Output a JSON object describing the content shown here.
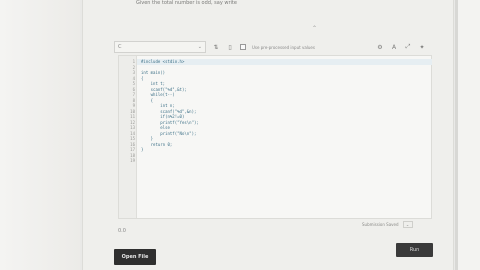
{
  "problem": {
    "statement": "Given the total number is odd, say write",
    "caret": "⌃"
  },
  "toolbar": {
    "language_value": "C",
    "language_chevron": "⌄",
    "checkbox_label": "Use pre-processed input values",
    "icons": [
      "settings-icon",
      "font-icon",
      "fullscreen-icon",
      "gear-icon"
    ]
  },
  "editor": {
    "lines": [
      {
        "n": "1",
        "code": "#include <stdio.h>"
      },
      {
        "n": "2",
        "code": ""
      },
      {
        "n": "3",
        "code": "int main()"
      },
      {
        "n": "4",
        "code": "{"
      },
      {
        "n": "5",
        "code": "    int t;"
      },
      {
        "n": "6",
        "code": "    scanf(\"%d\",&t);"
      },
      {
        "n": "7",
        "code": "    while(t--)"
      },
      {
        "n": "8",
        "code": "    {"
      },
      {
        "n": "9",
        "code": "        int n;"
      },
      {
        "n": "10",
        "code": "        scanf(\"%d\",&n);"
      },
      {
        "n": "11",
        "code": "        if(n%2!=0)"
      },
      {
        "n": "12",
        "code": "        printf(\"Yes\\n\");"
      },
      {
        "n": "13",
        "code": "        else"
      },
      {
        "n": "14",
        "code": "        printf(\"No\\n\");"
      },
      {
        "n": "15",
        "code": "    }"
      },
      {
        "n": "16",
        "code": "    return 0;"
      },
      {
        "n": "17",
        "code": "}"
      },
      {
        "n": "18",
        "code": ""
      },
      {
        "n": "19",
        "code": ""
      }
    ]
  },
  "status": {
    "label": "Submission Saved",
    "box": "⌄"
  },
  "version": "0.0",
  "buttons": {
    "open_file": "Open File",
    "run": "Run"
  },
  "colors": {
    "code": "#3b6f86",
    "button_dark": "#2f2f2f"
  }
}
